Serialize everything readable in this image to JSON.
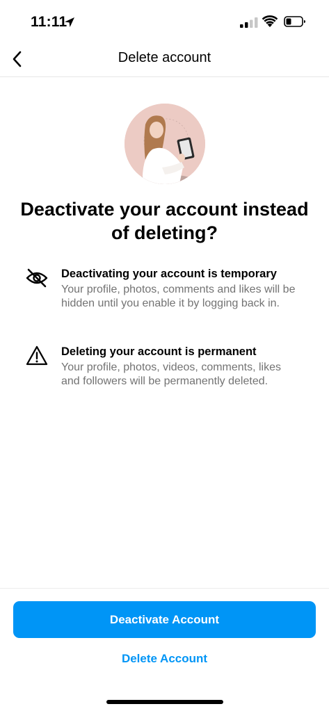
{
  "status_bar": {
    "time": "11:11",
    "icons": [
      "location-arrow-icon",
      "cellular-signal-icon",
      "wifi-icon",
      "battery-icon"
    ]
  },
  "nav": {
    "title": "Delete account",
    "back_icon": "chevron-left-icon"
  },
  "avatar": {
    "icon": "profile-photo"
  },
  "headline": "Deactivate your account instead of deleting?",
  "info_items": [
    {
      "icon": "eye-slash-icon",
      "title": "Deactivating your account is temporary",
      "description": "Your profile, photos, comments and likes will be hidden until you enable it by logging back in."
    },
    {
      "icon": "warning-triangle-icon",
      "title": "Deleting your account is permanent",
      "description": "Your profile, photos, videos, comments, likes and followers will be permanently deleted."
    }
  ],
  "actions": {
    "deactivate_label": "Deactivate Account",
    "delete_label": "Delete Account"
  },
  "colors": {
    "accent": "#0095f6",
    "secondary_text": "#737373",
    "avatar_background": "#eccbc4"
  }
}
